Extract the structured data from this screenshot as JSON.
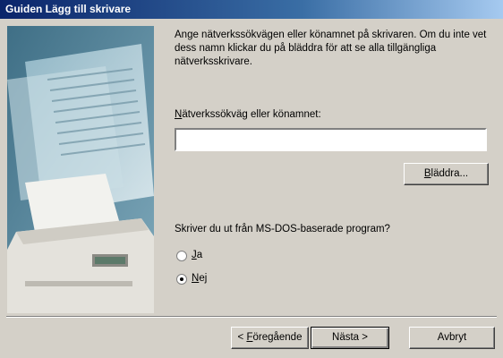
{
  "window": {
    "title": "Guiden Lägg till skrivare"
  },
  "main": {
    "description": "Ange nätverkssökvägen eller könamnet på skrivaren. Om du inte vet dess namn klickar du på bläddra för att se alla tillgängliga nätverksskrivare.",
    "path_label_accel": "N",
    "path_label_rest": "ätverkssökväg eller könamnet:",
    "path_value": "",
    "browse_accel": "B",
    "browse_rest": "läddra...",
    "msdos_question": "Skriver du ut från MS-DOS-baserade program?",
    "radio_yes_accel": "J",
    "radio_yes_rest": "a",
    "radio_no_accel": "N",
    "radio_no_rest": "ej",
    "selected": "Nej"
  },
  "footer": {
    "back_prefix": "< ",
    "back_accel": "F",
    "back_rest": "öregående",
    "next_label": "Nästa >",
    "cancel_label": "Avbryt"
  },
  "colors": {
    "titlebar_start": "#0a246a",
    "titlebar_end": "#a6caf0",
    "dialog_bg": "#d4d0c8"
  }
}
